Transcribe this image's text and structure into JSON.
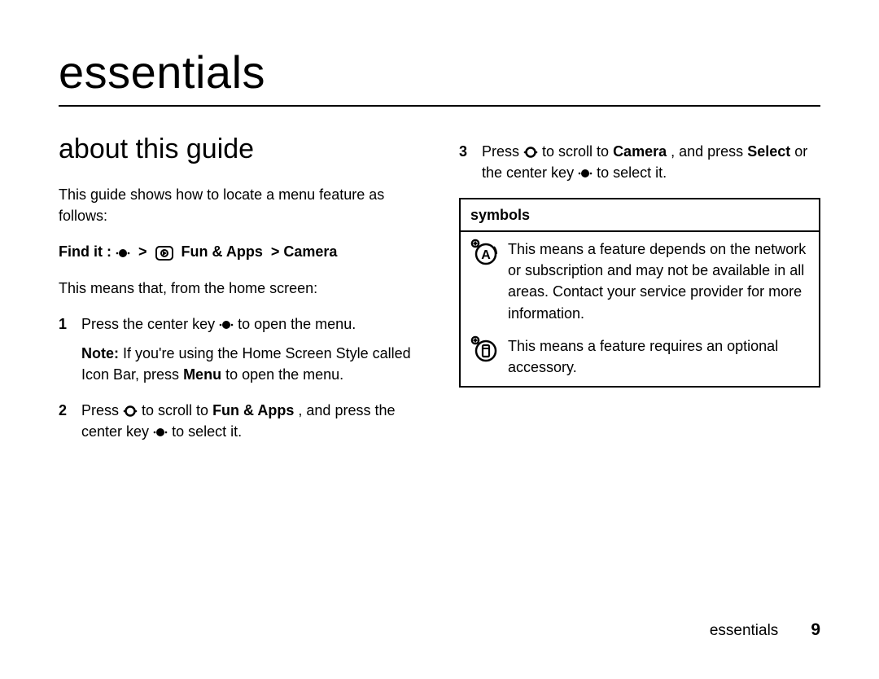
{
  "title": "essentials",
  "section_heading": "about this guide",
  "intro": "This guide shows how to locate a menu feature as follows:",
  "find_prefix": "Find it : ",
  "find_path_a": "Fun & Apps",
  "find_path_b": "Camera",
  "after_find": "This means that, from the home screen:",
  "steps": {
    "s1": {
      "num": "1",
      "a": "Press the center key ",
      "b": " to open the menu."
    },
    "s1_note": {
      "a": "Note:",
      "b": " If you're using the Home Screen Style called Icon Bar, press ",
      "menu": "Menu",
      "c": " to open the menu."
    },
    "s2": {
      "num": "2",
      "a": "Press ",
      "b": " to scroll to ",
      "target": "Fun & Apps",
      "c": ", and press the center key ",
      "d": " to select it."
    },
    "s3": {
      "num": "3",
      "a": "Press ",
      "b": " to scroll to ",
      "target": "Camera",
      "c": ", and press ",
      "select": "Select",
      "d": " or the center key ",
      "e": " to select it."
    }
  },
  "symbols": {
    "heading": "symbols",
    "row1": "This means a feature depends on the network or subscription and may not be available in all areas. Contact your service provider for more information.",
    "row2": "This means a feature requires an optional accessory."
  },
  "footer_label": "essentials",
  "page_number": "9"
}
